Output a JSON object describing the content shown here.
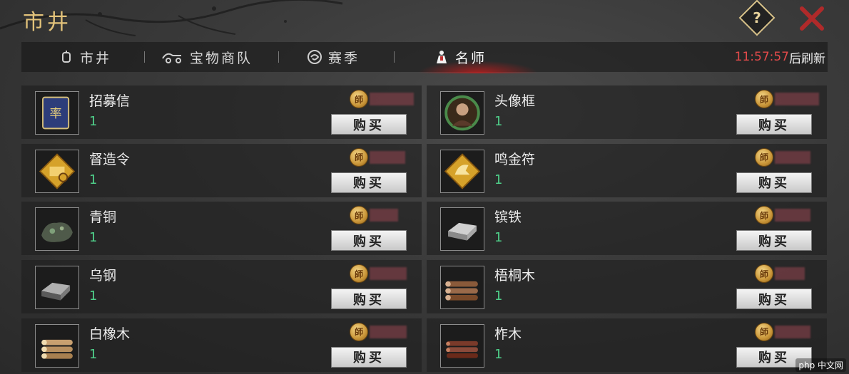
{
  "header": {
    "title": "市井",
    "help_label": "?"
  },
  "tabs": [
    {
      "label": "市井",
      "icon": "lantern-icon",
      "active": false
    },
    {
      "label": "宝物商队",
      "icon": "caravan-icon",
      "active": false
    },
    {
      "label": "赛季",
      "icon": "swirl-icon",
      "active": false
    },
    {
      "label": "名师",
      "icon": "master-icon",
      "active": true
    }
  ],
  "refresh": {
    "time": "11:57:57",
    "suffix": "后刷新"
  },
  "currency": {
    "label": "師",
    "price_state": "obscured"
  },
  "items": [
    {
      "name": "招募信",
      "qty": "1",
      "buy": "购买",
      "icon": "recruit-letter-icon"
    },
    {
      "name": "头像框",
      "qty": "1",
      "buy": "购买",
      "icon": "avatar-frame-icon"
    },
    {
      "name": "督造令",
      "qty": "1",
      "buy": "购买",
      "icon": "build-order-icon"
    },
    {
      "name": "鸣金符",
      "qty": "1",
      "buy": "购买",
      "icon": "retreat-charm-icon"
    },
    {
      "name": "青铜",
      "qty": "1",
      "buy": "购买",
      "icon": "bronze-ore-icon"
    },
    {
      "name": "镔铁",
      "qty": "1",
      "buy": "购买",
      "icon": "iron-ingot-icon"
    },
    {
      "name": "乌钢",
      "qty": "1",
      "buy": "购买",
      "icon": "black-steel-icon"
    },
    {
      "name": "梧桐木",
      "qty": "1",
      "buy": "购买",
      "icon": "wutong-wood-icon"
    },
    {
      "name": "白橡木",
      "qty": "1",
      "buy": "购买",
      "icon": "white-oak-icon"
    },
    {
      "name": "柞木",
      "qty": "1",
      "buy": "购买",
      "icon": "oak-wood-icon"
    }
  ],
  "watermark": "php 中文网",
  "colors": {
    "title_gold": "#e2c27a",
    "timer_red": "#e24a4a",
    "qty_green": "#4fd08a",
    "close_red": "#b02a2a"
  }
}
